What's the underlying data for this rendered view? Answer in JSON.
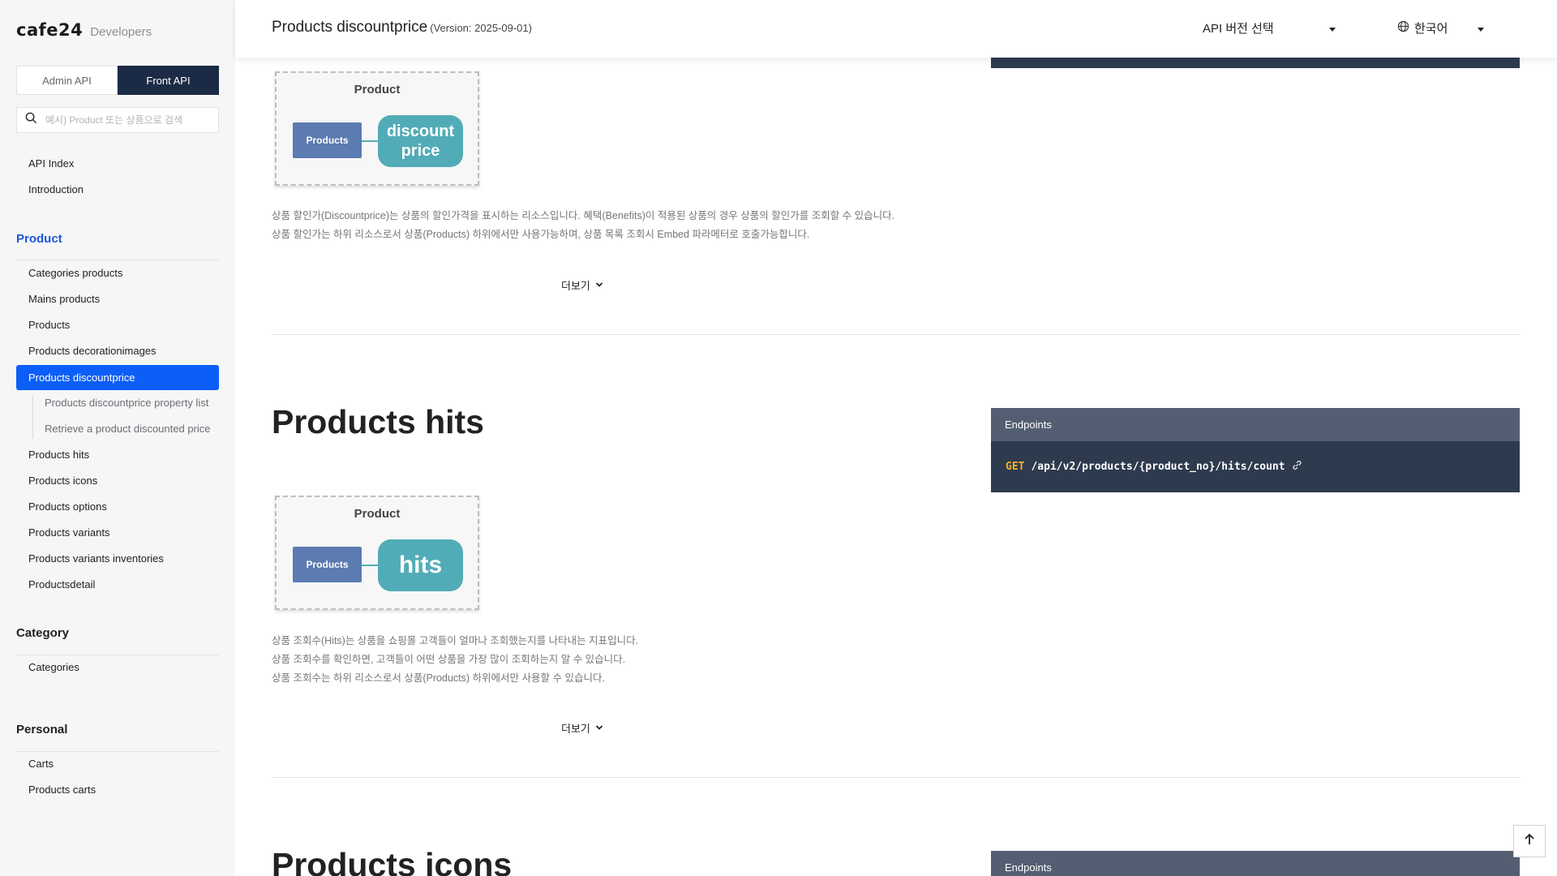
{
  "sidebar": {
    "logo": "cafe24",
    "logo_sub": "Developers",
    "tabs": [
      "Admin API",
      "Front API"
    ],
    "search_placeholder": "예시) Product 또는 상품으로 검색",
    "top_links": [
      "API Index",
      "Introduction"
    ],
    "product_heading": "Product",
    "product_items": [
      "Categories products",
      "Mains products",
      "Products",
      "Products decorationimages"
    ],
    "active_item": "Products discountprice",
    "sub_items": [
      "Products discountprice property list",
      "Retrieve a product discounted price"
    ],
    "product_items_after": [
      "Products hits",
      "Products icons",
      "Products options",
      "Products variants",
      "Products variants inventories",
      "Productsdetail"
    ],
    "category_heading": "Category",
    "category_items": [
      "Categories"
    ],
    "personal_heading": "Personal",
    "personal_items": [
      "Carts",
      "Products carts"
    ]
  },
  "header": {
    "title": "Products discountprice",
    "version": "(Version: 2025-09-01)",
    "version_select": "API 버전 선택",
    "language": "한국어"
  },
  "sections": {
    "discountprice": {
      "diagram_label": "Product",
      "diagram_box": "Products",
      "diagram_pill": "discount price",
      "desc": [
        "상품 할인가(Discountprice)는 상품의 할인가격을 표시하는 리소스입니다. 혜택(Benefits)이 적용된 상품의 경우 상품의 할인가를 조회할 수 있습니다.",
        "상품 할인가는 하위 리소스로서 상품(Products) 하위에서만 사용가능하며, 상품 목록 조회시 Embed 파라메터로 호출가능합니다."
      ],
      "more": "더보기"
    },
    "hits": {
      "title": "Products hits",
      "endpoints_label": "Endpoints",
      "method": "GET",
      "path": "/api/v2/products/{product_no}/hits/count",
      "diagram_label": "Product",
      "diagram_box": "Products",
      "diagram_pill": "hits",
      "desc": [
        "상품 조회수(Hits)는 상품을 쇼핑몰 고객들이 얼마나 조회했는지를 나타내는 지표입니다.",
        "상품 조회수를 확인하면, 고객들이 어떤 상품을 가장 많이 조회하는지 알 수 있습니다.",
        "상품 조회수는 하위 리소스로서 상품(Products) 하위에서만 사용할 수 있습니다."
      ],
      "more": "더보기"
    },
    "icons": {
      "title": "Products icons",
      "endpoints_label": "Endpoints"
    }
  },
  "colors": {
    "active_nav": "#0b5ef7",
    "endpoint_header": "#535e72",
    "endpoint_body": "#2e3a4e",
    "get_method": "#f6b128",
    "diagram_box": "#5b7bb1",
    "diagram_pill": "#52acb7"
  }
}
